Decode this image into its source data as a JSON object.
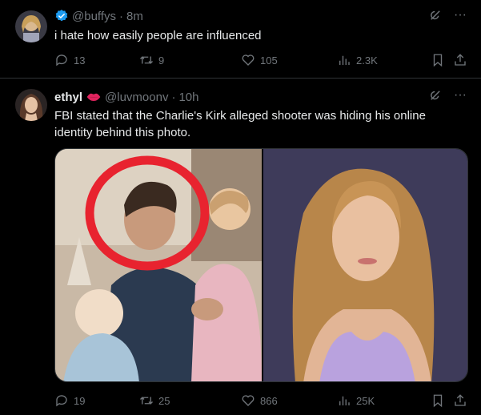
{
  "tweet1": {
    "handle": "@buffys",
    "dot": "·",
    "time": "8m",
    "text": "i hate how easily people are influenced",
    "replies": "13",
    "reposts": "9",
    "likes": "105",
    "views": "2.3K"
  },
  "tweet2": {
    "name": "ethyl",
    "handle": "@luvmoonv",
    "dot": "·",
    "time": "10h",
    "text": "FBI stated that the Charlie's Kirk alleged shooter was hiding his online identity behind this photo.",
    "replies": "19",
    "reposts": "25",
    "likes": "866",
    "views": "25K"
  },
  "icons": {
    "grok": "grok-icon",
    "more": "more-icon",
    "more_glyph": "···",
    "reply": "reply-icon",
    "repost": "repost-icon",
    "like": "heart-icon",
    "views": "views-icon",
    "bookmark": "bookmark-icon",
    "share": "share-icon",
    "verified": "verified-badge-icon",
    "emoji": "lips-emoji-icon"
  },
  "colors": {
    "background": "#000000",
    "text": "#e7e9ea",
    "muted": "#71767b",
    "verified": "#1d9bf0",
    "divider": "#2f3336",
    "circle": "#e8232f"
  }
}
